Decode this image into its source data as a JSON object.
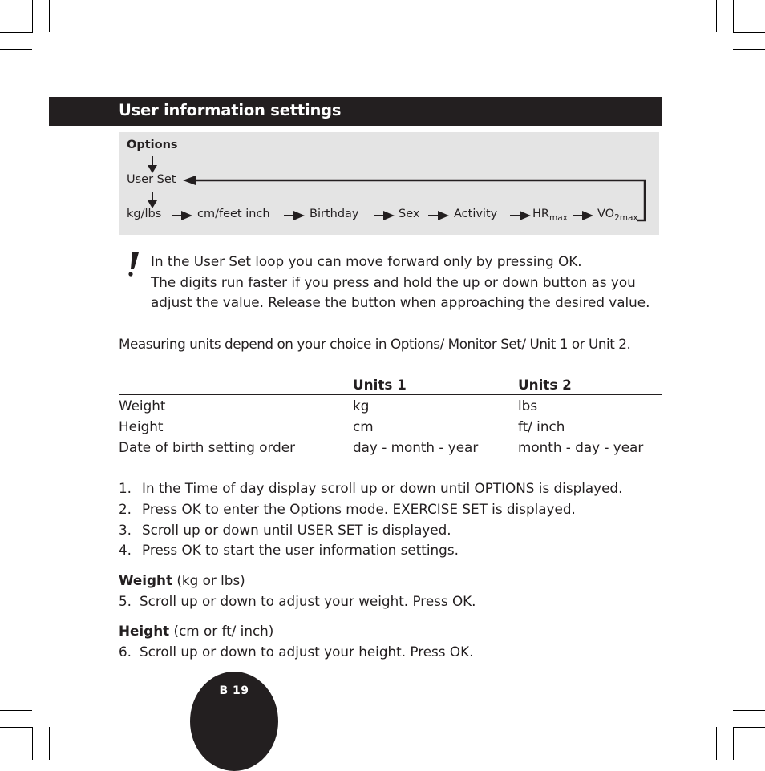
{
  "header": {
    "title": "User information settings"
  },
  "flow_diagram": {
    "root": "Options",
    "loop_start": "User Set",
    "sequence": [
      {
        "label": "kg/lbs"
      },
      {
        "label": "cm/feet inch"
      },
      {
        "label": "Birthday"
      },
      {
        "label": "Sex"
      },
      {
        "label": "Activity"
      },
      {
        "label": "HR",
        "sub": "max"
      },
      {
        "label": "VO",
        "sub": "2max"
      }
    ]
  },
  "note": {
    "icon": "exclamation-icon",
    "lines": [
      "In the User Set loop you can move forward only by pressing OK.",
      "The digits run faster if you press and hold the up or down button as you",
      "adjust the value. Release the button when approaching the desired value."
    ]
  },
  "units_intro": "Measuring units depend on your choice in Options/ Monitor Set/ Unit 1 or Unit 2.",
  "units_table": {
    "headers": [
      "",
      "Units 1",
      "Units 2"
    ],
    "rows": [
      [
        "Weight",
        "kg",
        "lbs"
      ],
      [
        "Height",
        "cm",
        "ft/ inch"
      ],
      [
        "Date of birth setting order",
        "day - month - year",
        "month - day - year"
      ]
    ]
  },
  "steps": [
    {
      "num": "1.",
      "text": "In the Time of day display scroll up or down until OPTIONS is displayed."
    },
    {
      "num": "2.",
      "text": "Press OK to enter the Options mode. EXERCISE SET is displayed."
    },
    {
      "num": "3.",
      "text": "Scroll up or down until USER SET is displayed."
    },
    {
      "num": "4.",
      "text": "Press OK to start the user information settings."
    }
  ],
  "sections": [
    {
      "title": "Weight",
      "units": "(kg or lbs)",
      "step_num": "5.",
      "step_text": "Scroll up or down to adjust your weight. Press OK."
    },
    {
      "title": "Height",
      "units": "(cm or ft/ inch)",
      "step_num": "6.",
      "step_text": "Scroll up or down to adjust your height. Press OK."
    }
  ],
  "page": {
    "number": "B 19"
  },
  "colors": {
    "ink": "#231f20",
    "panel": "#e4e4e4",
    "paper": "#ffffff"
  }
}
